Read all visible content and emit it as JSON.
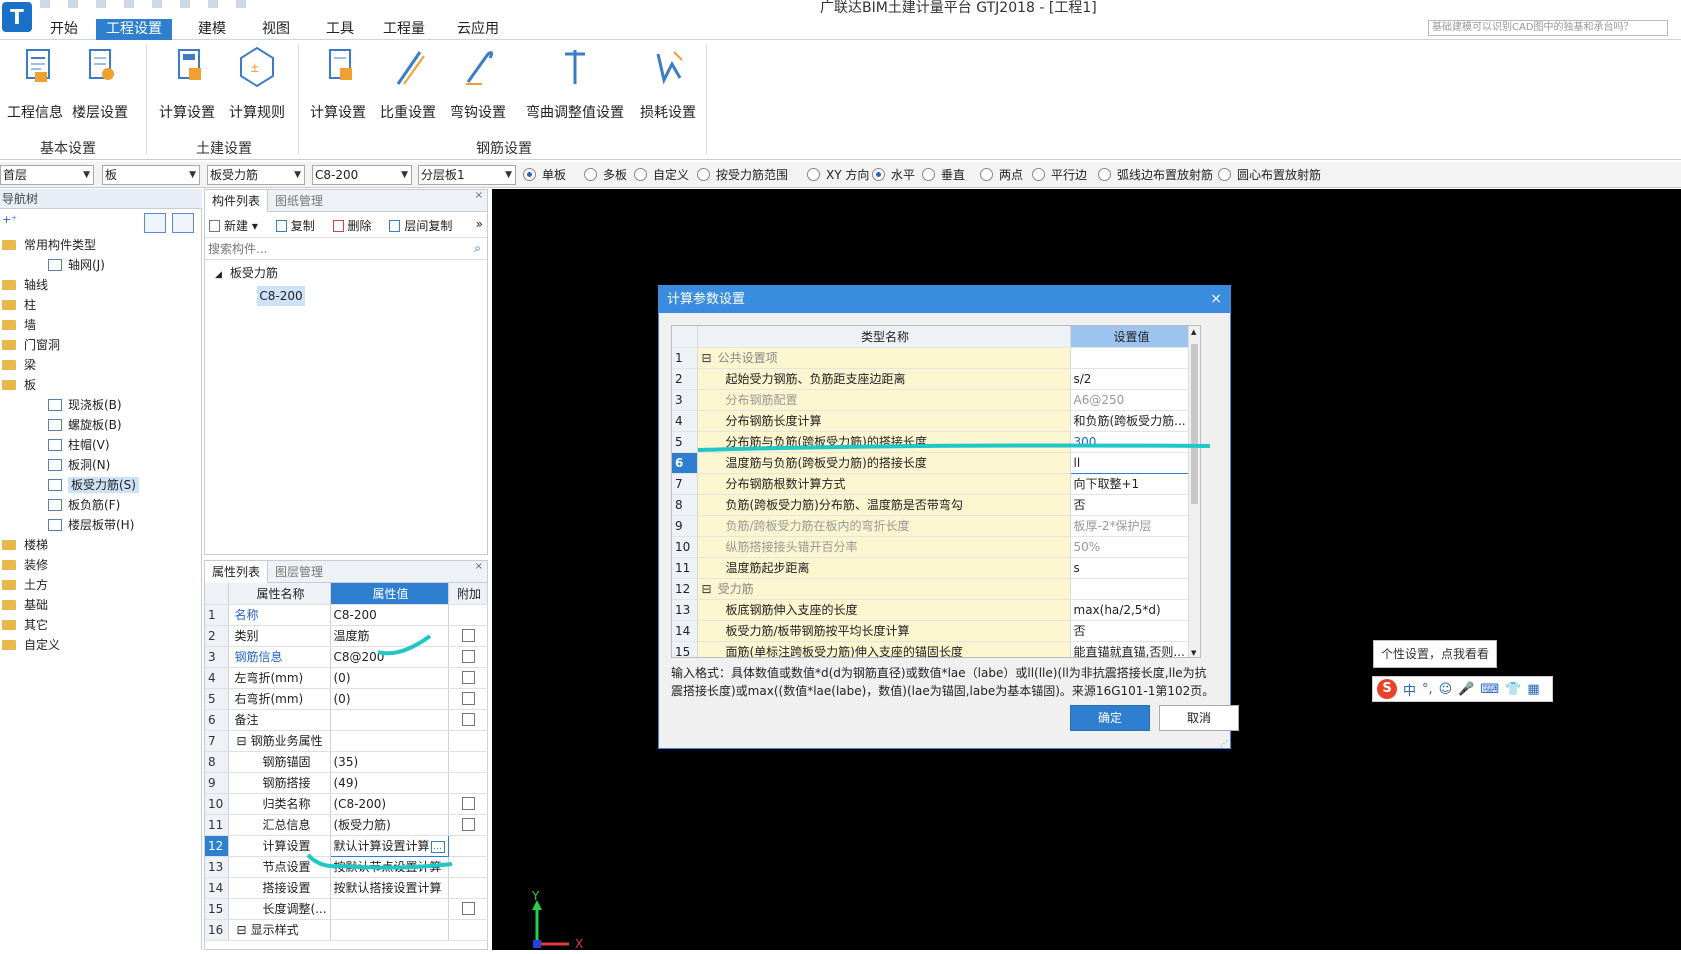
{
  "app": {
    "title": "广联达BIM土建计量平台 GTJ2018 - [工程1]",
    "logo": "T",
    "search_placeholder": "基础建模可以识别CAD图中的独基和承台吗？"
  },
  "menu": [
    "开始",
    "工程设置",
    "建模",
    "视图",
    "工具",
    "工程量",
    "云应用"
  ],
  "menu_active": 1,
  "ribbon": {
    "groups": [
      {
        "label": "基本设置",
        "buttons": [
          "工程信息",
          "楼层设置"
        ]
      },
      {
        "label": "土建设置",
        "buttons": [
          "计算设置",
          "计算规则"
        ]
      },
      {
        "label": "钢筋设置",
        "buttons": [
          "计算设置",
          "比重设置",
          "弯钩设置",
          "弯曲调整值设置",
          "损耗设置"
        ]
      }
    ]
  },
  "toolbar": {
    "combos": [
      "首层",
      "板",
      "板受力筋",
      "C8-200",
      "分层板1"
    ],
    "radios": [
      {
        "label": "单板",
        "on": true
      },
      {
        "label": "多板",
        "on": false
      },
      {
        "label": "自定义",
        "on": false
      },
      {
        "label": "按受力筋范围",
        "on": false
      },
      {
        "label": "XY 方向",
        "on": false
      },
      {
        "label": "水平",
        "on": true
      },
      {
        "label": "垂直",
        "on": false
      },
      {
        "label": "两点",
        "on": false
      },
      {
        "label": "平行边",
        "on": false
      },
      {
        "label": "弧线边布置放射筋",
        "on": false
      },
      {
        "label": "圆心布置放射筋",
        "on": false
      }
    ]
  },
  "nav": {
    "title": "导航树",
    "items": [
      {
        "label": "常用构件类型",
        "level": 0,
        "folder": true
      },
      {
        "label": "轴网(J)",
        "level": 1
      },
      {
        "label": "轴线",
        "level": 0,
        "folder": true
      },
      {
        "label": "柱",
        "level": 0,
        "folder": true
      },
      {
        "label": "墙",
        "level": 0,
        "folder": true
      },
      {
        "label": "门窗洞",
        "level": 0,
        "folder": true
      },
      {
        "label": "梁",
        "level": 0,
        "folder": true
      },
      {
        "label": "板",
        "level": 0,
        "folder": true
      },
      {
        "label": "现浇板(B)",
        "level": 1
      },
      {
        "label": "螺旋板(B)",
        "level": 1
      },
      {
        "label": "柱帽(V)",
        "level": 1
      },
      {
        "label": "板洞(N)",
        "level": 1
      },
      {
        "label": "板受力筋(S)",
        "level": 1,
        "selected": true
      },
      {
        "label": "板负筋(F)",
        "level": 1
      },
      {
        "label": "楼层板带(H)",
        "level": 1
      },
      {
        "label": "楼梯",
        "level": 0,
        "folder": true
      },
      {
        "label": "装修",
        "level": 0,
        "folder": true
      },
      {
        "label": "土方",
        "level": 0,
        "folder": true
      },
      {
        "label": "基础",
        "level": 0,
        "folder": true
      },
      {
        "label": "其它",
        "level": 0,
        "folder": true
      },
      {
        "label": "自定义",
        "level": 0,
        "folder": true
      }
    ]
  },
  "component_list": {
    "tabs": [
      "构件列表",
      "图纸管理"
    ],
    "actions": [
      "新建",
      "复制",
      "删除",
      "层间复制"
    ],
    "search_placeholder": "搜索构件...",
    "tree_root": "板受力筋",
    "tree_child": "C8-200"
  },
  "properties": {
    "tabs": [
      "属性列表",
      "图层管理"
    ],
    "headers": [
      "属性名称",
      "属性值",
      "附加"
    ],
    "rows": [
      {
        "n": "1",
        "name": "名称",
        "value": "C8-200",
        "blue": true,
        "chk": false
      },
      {
        "n": "2",
        "name": "类别",
        "value": "温度筋",
        "chk": true
      },
      {
        "n": "3",
        "name": "钢筋信息",
        "value": "C8@200",
        "blue": true,
        "chk": true
      },
      {
        "n": "4",
        "name": "左弯折(mm)",
        "value": "(0)",
        "chk": true
      },
      {
        "n": "5",
        "name": "右弯折(mm)",
        "value": "(0)",
        "chk": true
      },
      {
        "n": "6",
        "name": "备注",
        "value": "",
        "chk": true
      },
      {
        "n": "7",
        "name": "钢筋业务属性",
        "value": "",
        "group": true
      },
      {
        "n": "8",
        "name": "钢筋锚固",
        "value": "(35)",
        "indent": true
      },
      {
        "n": "9",
        "name": "钢筋搭接",
        "value": "(49)",
        "indent": true
      },
      {
        "n": "10",
        "name": "归类名称",
        "value": "(C8-200)",
        "indent": true,
        "chk": true
      },
      {
        "n": "11",
        "name": "汇总信息",
        "value": "(板受力筋)",
        "indent": true,
        "chk": true
      },
      {
        "n": "12",
        "name": "计算设置",
        "value": "默认计算设置计算",
        "indent": true,
        "active": true
      },
      {
        "n": "13",
        "name": "节点设置",
        "value": "按默认节点设置计算",
        "indent": true
      },
      {
        "n": "14",
        "name": "搭接设置",
        "value": "按默认搭接设置计算",
        "indent": true
      },
      {
        "n": "15",
        "name": "长度调整(...",
        "value": "",
        "indent": true,
        "chk": true
      },
      {
        "n": "16",
        "name": "显示样式",
        "value": "",
        "group": true
      }
    ]
  },
  "dialog": {
    "title": "计算参数设置",
    "headers": [
      "类型名称",
      "设置值"
    ],
    "rows": [
      {
        "n": "1",
        "name": "公共设置项",
        "value": "",
        "group": true
      },
      {
        "n": "2",
        "name": "起始受力钢筋、负筋距支座边距离",
        "value": "s/2"
      },
      {
        "n": "3",
        "name": "分布钢筋配置",
        "value": "A6@250",
        "gray": true
      },
      {
        "n": "4",
        "name": "分布钢筋长度计算",
        "value": "和负筋(跨板受力筋..."
      },
      {
        "n": "5",
        "name": "分布筋与负筋(跨板受力筋)的搭接长度",
        "value": "300",
        "blueval": true
      },
      {
        "n": "6",
        "name": "温度筋与负筋(跨板受力筋)的搭接长度",
        "value": "ll",
        "active": true
      },
      {
        "n": "7",
        "name": "分布钢筋根数计算方式",
        "value": "向下取整+1"
      },
      {
        "n": "8",
        "name": "负筋(跨板受力筋)分布筋、温度筋是否带弯勾",
        "value": "否"
      },
      {
        "n": "9",
        "name": "负筋/跨板受力筋在板内的弯折长度",
        "value": "板厚-2*保护层",
        "gray": true
      },
      {
        "n": "10",
        "name": "纵筋搭接接头错开百分率",
        "value": "50%",
        "gray": true
      },
      {
        "n": "11",
        "name": "温度筋起步距离",
        "value": "s"
      },
      {
        "n": "12",
        "name": "受力筋",
        "value": "",
        "group": true
      },
      {
        "n": "13",
        "name": "板底钢筋伸入支座的长度",
        "value": "max(ha/2,5*d)"
      },
      {
        "n": "14",
        "name": "板受力筋/板带钢筋按平均长度计算",
        "value": "否"
      },
      {
        "n": "15",
        "name": "面筋(单标注跨板受力筋)伸入支座的锚固长度",
        "value": "能直锚就直锚,否则..."
      }
    ],
    "help": "输入格式：具体数值或数值*d(d为钢筋直径)或数值*lae（labe）或ll(lle)(ll为非抗震搭接长度,lle为抗震搭接长度)或max((数值*lae(labe)，数值)(lae为锚固,labe为基本锚固)。来源16G101-1第102页。",
    "ok": "确定",
    "cancel": "取消"
  },
  "ime": {
    "tip": "个性设置，点我看看",
    "icons": [
      "S",
      "中",
      "°,",
      "☺",
      "🎤",
      "⌨",
      "👕",
      "▦"
    ]
  },
  "axis": {
    "y": "Y",
    "x": "X"
  },
  "colors": {
    "accent": "#2f7fd0",
    "highlight": "#1fc7c7"
  }
}
